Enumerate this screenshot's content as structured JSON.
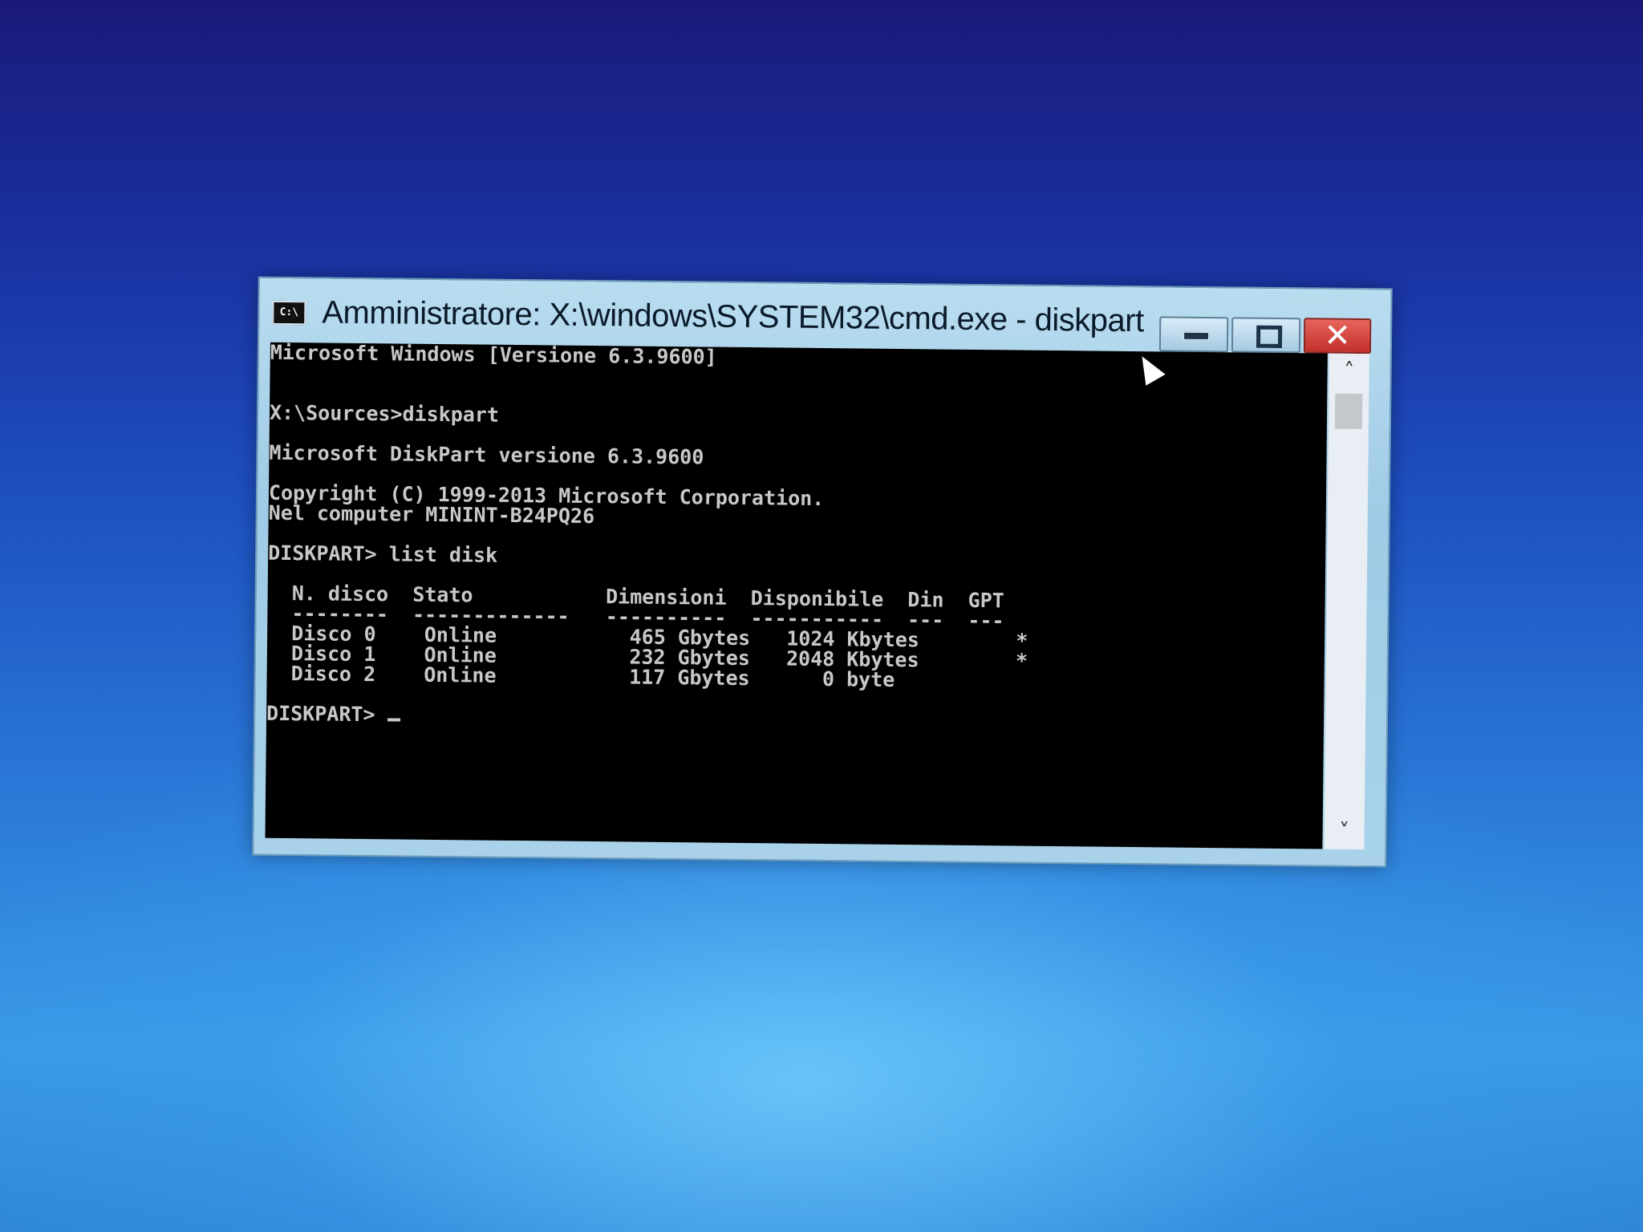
{
  "window": {
    "icon_label": "C:\\",
    "title": "Amministratore: X:\\windows\\SYSTEM32\\cmd.exe - diskpart",
    "buttons": {
      "minimize_icon": "minimize-icon",
      "maximize_icon": "maximize-icon",
      "close_icon": "close-icon",
      "close_glyph": "✕"
    }
  },
  "console": {
    "lines": [
      "Microsoft Windows [Versione 6.3.9600]",
      "",
      "",
      "X:\\Sources>diskpart",
      "",
      "Microsoft DiskPart versione 6.3.9600",
      "",
      "Copyright (C) 1999-2013 Microsoft Corporation.",
      "Nel computer MININT-B24PQ26",
      "",
      "DISKPART> list disk",
      "",
      "  N. disco  Stato           Dimensioni  Disponibile  Din  GPT",
      "  --------  -------------   ----------  -----------  ---  ---",
      "  Disco 0    Online           465 Gbytes   1024 Kbytes        *",
      "  Disco 1    Online           232 Gbytes   2048 Kbytes        *",
      "  Disco 2    Online           117 Gbytes      0 byte",
      "",
      "DISKPART> "
    ]
  },
  "scrollbar": {
    "up_arrow": "˄",
    "down_arrow": "˅"
  }
}
